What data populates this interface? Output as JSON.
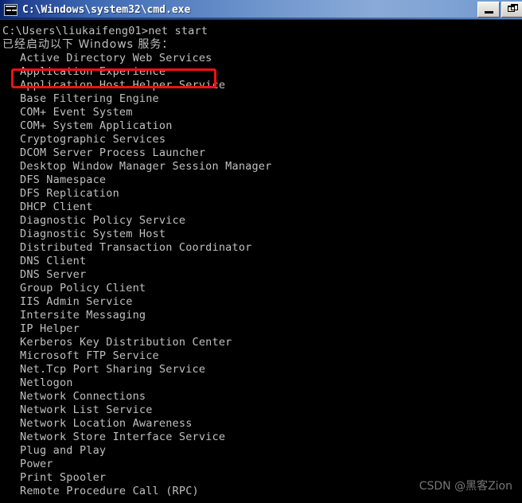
{
  "window": {
    "title": "C:\\Windows\\system32\\cmd.exe",
    "icon": "cmd-console-icon",
    "titlebar_color_left": "#0a246a",
    "titlebar_color_right": "#8aaad8",
    "buttons": [
      {
        "name": "minimize",
        "label": "_"
      },
      {
        "name": "restore",
        "label": "❐"
      }
    ]
  },
  "console": {
    "background_color": "#000000",
    "text_color": "#c0c0c0",
    "prompt_line": "C:\\Users\\liukaifeng01>net start",
    "status_line": "已经启动以下 Windows 服务：",
    "services": [
      "Active Directory Web Services",
      "Application Experience",
      "Application Host Helper Service",
      "Base Filtering Engine",
      "COM+ Event System",
      "COM+ System Application",
      "Cryptographic Services",
      "DCOM Server Process Launcher",
      "Desktop Window Manager Session Manager",
      "DFS Namespace",
      "DFS Replication",
      "DHCP Client",
      "Diagnostic Policy Service",
      "Diagnostic System Host",
      "Distributed Transaction Coordinator",
      "DNS Client",
      "DNS Server",
      "Group Policy Client",
      "IIS Admin Service",
      "Intersite Messaging",
      "IP Helper",
      "Kerberos Key Distribution Center",
      "Microsoft FTP Service",
      "Net.Tcp Port Sharing Service",
      "Netlogon",
      "Network Connections",
      "Network List Service",
      "Network Location Awareness",
      "Network Store Interface Service",
      "Plug and Play",
      "Power",
      "Print Spooler",
      "Remote Procedure Call (RPC)"
    ]
  },
  "annotation": {
    "highlight_target": "Active Directory Web Services",
    "highlight_color": "#ee1111"
  },
  "watermark": {
    "text": "CSDN @黑客Zion",
    "color": "#7e7e7e"
  }
}
